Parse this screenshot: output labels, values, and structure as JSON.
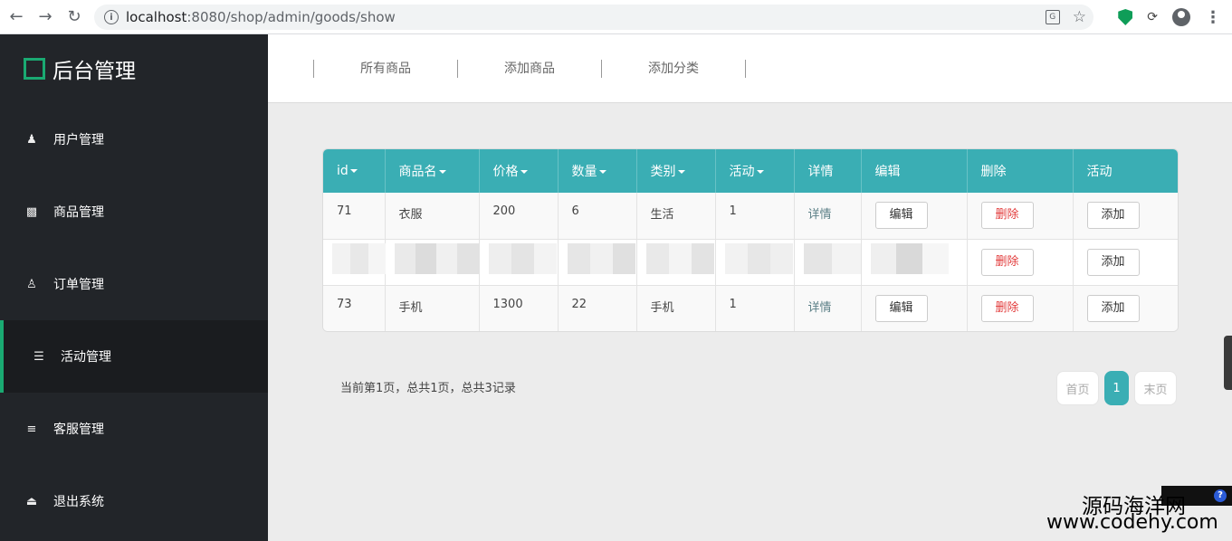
{
  "browser": {
    "url_host": "localhost",
    "url_rest": ":8080/shop/admin/goods/show"
  },
  "sidebar": {
    "brand": "后台管理",
    "items": [
      {
        "label": "用户管理",
        "icon": "user-icon"
      },
      {
        "label": "商品管理",
        "icon": "bar-chart-icon"
      },
      {
        "label": "订单管理",
        "icon": "users-icon"
      },
      {
        "label": "活动管理",
        "icon": "database-icon",
        "active": true
      },
      {
        "label": "客服管理",
        "icon": "sliders-icon"
      },
      {
        "label": "退出系统",
        "icon": "eject-icon"
      }
    ]
  },
  "topnav": {
    "links": [
      "所有商品",
      "添加商品",
      "添加分类"
    ]
  },
  "table": {
    "headers": [
      "id",
      "商品名",
      "价格",
      "数量",
      "类别",
      "活动",
      "详情",
      "编辑",
      "删除",
      "活动"
    ],
    "rows": [
      {
        "id": "71",
        "name": "衣服",
        "price": "200",
        "qty": "6",
        "category": "生活",
        "activity": "1",
        "detail": "详情",
        "edit": "编辑",
        "delete": "删除",
        "add": "添加"
      },
      {
        "id": "",
        "name": "",
        "price": "",
        "qty": "",
        "category": "",
        "activity": "",
        "detail": "",
        "edit": "",
        "delete": "删除",
        "add": "添加"
      },
      {
        "id": "73",
        "name": "手机",
        "price": "1300",
        "qty": "22",
        "category": "手机",
        "activity": "1",
        "detail": "详情",
        "edit": "编辑",
        "delete": "删除",
        "add": "添加"
      }
    ]
  },
  "pagination": {
    "info": "当前第1页，总共1页，总共3记录",
    "first": "首页",
    "current": "1",
    "last": "末页"
  },
  "watermark": {
    "line1": "源码海洋网",
    "line2": "www.codehy.com"
  },
  "colors": {
    "accent": "#3aaeb4",
    "sidebar_bg": "#222529",
    "brand_green": "#1aaa72",
    "delete_red": "#e23b3b"
  }
}
